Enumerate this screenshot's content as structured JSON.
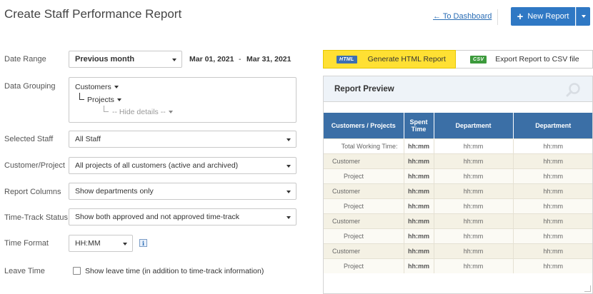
{
  "header": {
    "title": "Create Staff Performance Report",
    "dashboard_link": "← To Dashboard",
    "new_report_label": "New Report"
  },
  "form": {
    "date_range": {
      "label": "Date Range",
      "value": "Previous month",
      "start": "Mar 01, 2021",
      "separator": "-",
      "end": "Mar 31, 2021"
    },
    "data_grouping": {
      "label": "Data Grouping",
      "level1": "Customers",
      "level2": "Projects",
      "level3": "-- Hide details --"
    },
    "selected_staff": {
      "label": "Selected Staff",
      "value": "All Staff"
    },
    "customer_project": {
      "label": "Customer/Project",
      "value": "All projects of all customers (active and archived)"
    },
    "report_columns": {
      "label": "Report Columns",
      "value": "Show departments only"
    },
    "time_track_status": {
      "label": "Time-Track Status",
      "value": "Show both approved and not approved time-track"
    },
    "time_format": {
      "label": "Time Format",
      "value": "HH:MM",
      "info": "i"
    },
    "leave_time": {
      "label": "Leave Time",
      "checkbox_label": "Show leave time (in addition to time-track information)",
      "checked": false
    }
  },
  "actions": {
    "html": {
      "badge": "HTML",
      "label": "Generate HTML Report"
    },
    "csv": {
      "badge": "CSV",
      "label": "Export Report to CSV file"
    }
  },
  "preview": {
    "title": "Report Preview",
    "columns": [
      "Customers / Projects",
      "Spent Time",
      "Department",
      "Department"
    ],
    "rows": [
      {
        "type": "total",
        "name": "Total Working Time:",
        "spent": "hh:mm",
        "d1": "hh:mm",
        "d2": "hh:mm"
      },
      {
        "type": "cust",
        "name": "Customer",
        "spent": "hh:mm",
        "d1": "hh:mm",
        "d2": "hh:mm"
      },
      {
        "type": "proj",
        "name": "Project",
        "spent": "hh:mm",
        "d1": "hh:mm",
        "d2": "hh:mm"
      },
      {
        "type": "cust",
        "name": "Customer",
        "spent": "hh:mm",
        "d1": "hh:mm",
        "d2": "hh:mm"
      },
      {
        "type": "proj",
        "name": "Project",
        "spent": "hh:mm",
        "d1": "hh:mm",
        "d2": "hh:mm"
      },
      {
        "type": "cust",
        "name": "Customer",
        "spent": "hh:mm",
        "d1": "hh:mm",
        "d2": "hh:mm"
      },
      {
        "type": "proj",
        "name": "Project",
        "spent": "hh:mm",
        "d1": "hh:mm",
        "d2": "hh:mm"
      },
      {
        "type": "cust",
        "name": "Customer",
        "spent": "hh:mm",
        "d1": "hh:mm",
        "d2": "hh:mm"
      },
      {
        "type": "proj",
        "name": "Project",
        "spent": "hh:mm",
        "d1": "hh:mm",
        "d2": "hh:mm"
      }
    ]
  },
  "colors": {
    "accent": "#2f78c4",
    "table_header": "#3b6fa6",
    "html_button": "#ffe033"
  }
}
